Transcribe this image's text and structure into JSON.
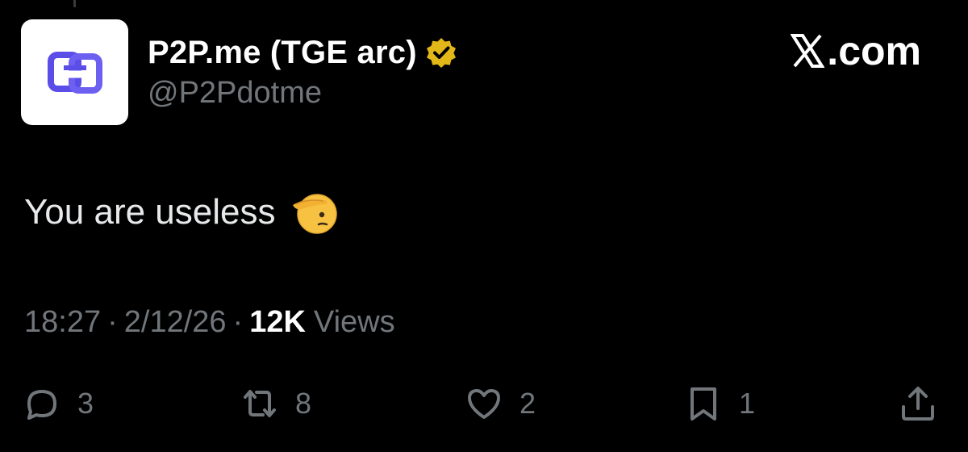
{
  "author": {
    "display_name": "P2P.me (TGE arc)",
    "handle": "@P2Pdotme",
    "verified": true,
    "avatar_icon": "p2p-logo-icon",
    "avatar_color": "#5b4de8"
  },
  "brand": {
    "label": ".com",
    "icon": "x-logo-icon"
  },
  "tweet": {
    "text": "You are useless",
    "emoji": "saluting-face-emoji"
  },
  "meta": {
    "time": "18:27",
    "separator": "·",
    "date": "2/12/26",
    "views_count": "12K",
    "views_label": "Views"
  },
  "actions": {
    "reply_count": "3",
    "repost_count": "8",
    "like_count": "2",
    "bookmark_count": "1"
  },
  "colors": {
    "background": "#000000",
    "primary_text": "#e7e9ea",
    "secondary_text": "#71767b",
    "verified_badge": "#e2b719"
  }
}
